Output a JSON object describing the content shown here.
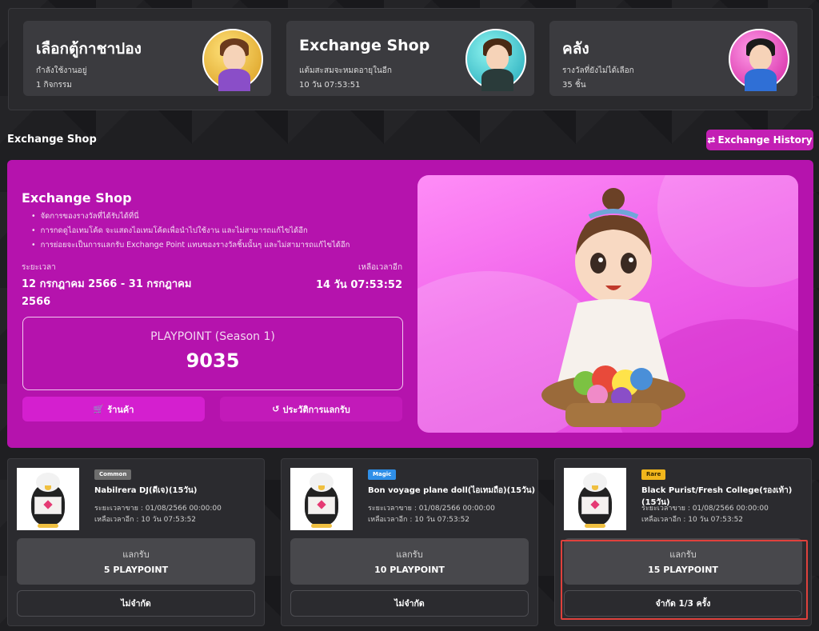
{
  "top_cards": [
    {
      "title": "เลือกตู้กาชาปอง",
      "sub": "กำลังใช้งานอยู่",
      "sub2": "1 กิจกรรม",
      "icon": "avatar-girl-orange"
    },
    {
      "title": "Exchange Shop",
      "sub": "แต้มสะสมจะหมดอายุในอีก",
      "sub2": "10 วัน 07:53:51",
      "icon": "avatar-boy-teal"
    },
    {
      "title": "คลัง",
      "sub": "รางวัลที่ยังไม่ได้เลือก",
      "sub2": "35 ชิ้น",
      "icon": "avatar-girl-pink"
    }
  ],
  "section": {
    "title": "Exchange Shop",
    "history_label": "Exchange History"
  },
  "banner": {
    "title": "Exchange Shop",
    "bullets": [
      "จัดการของรางวัลที่ได้รับได้ที่นี่",
      "การกดดูไอเทมโค้ด จะแสดงไอเทมโค้ดเพื่อนำไปใช้งาน และไม่สามารถแก้ไขได้อีก",
      "การย่อยจะเป็นการแลกรับ Exchange Point แทนของรางวัลชิ้นนั้นๆ และไม่สามารถแก้ไขได้อีก"
    ],
    "period_label": "ระยะเวลา",
    "period_value": "12 กรกฎาคม 2566 - 31 กรกฎาคม 2566",
    "remain_label": "เหลือเวลาอีก",
    "remain_value": "14 วัน 07:53:52",
    "points_label": "PLAYPOINT (Season 1)",
    "points_value": "9035",
    "shop_label": "ร้านค้า",
    "history_label": "ประวัติการแลกรับ"
  },
  "items": [
    {
      "badge": "Common",
      "badge_color": "#6d6d6d",
      "badge_text_color": "#ffffff",
      "name": "Nabilrera DJ(ดีเจ)(15วัน)",
      "sale_period": "ระยะเวลาขาย : 01/08/2566 00:00:00",
      "time_left": "เหลือเวลาอีก : 10 วัน 07:53:52",
      "exchange_label": "แลกรับ",
      "price": "5 PLAYPOINT",
      "limit": "ไม่จำกัด"
    },
    {
      "badge": "Magic",
      "badge_color": "#2f8fe8",
      "badge_text_color": "#ffffff",
      "name": "Bon voyage plane doll(ไอเทมถือ)(15วัน)",
      "sale_period": "ระยะเวลาขาย : 01/08/2566 00:00:00",
      "time_left": "เหลือเวลาอีก : 10 วัน 07:53:52",
      "exchange_label": "แลกรับ",
      "price": "10 PLAYPOINT",
      "limit": "ไม่จำกัด"
    },
    {
      "badge": "Rare",
      "badge_color": "#f2b61c",
      "badge_text_color": "#3a2a00",
      "name": "Black Purist/Fresh College(รองเท้า)(15วัน)",
      "sale_period": "ระยะเวลาขาย : 01/08/2566 00:00:00",
      "time_left": "เหลือเวลาอีก : 10 วัน 07:53:52",
      "exchange_label": "แลกรับ",
      "price": "15 PLAYPOINT",
      "limit": "จำกัด 1/3 ครั้ง"
    }
  ]
}
